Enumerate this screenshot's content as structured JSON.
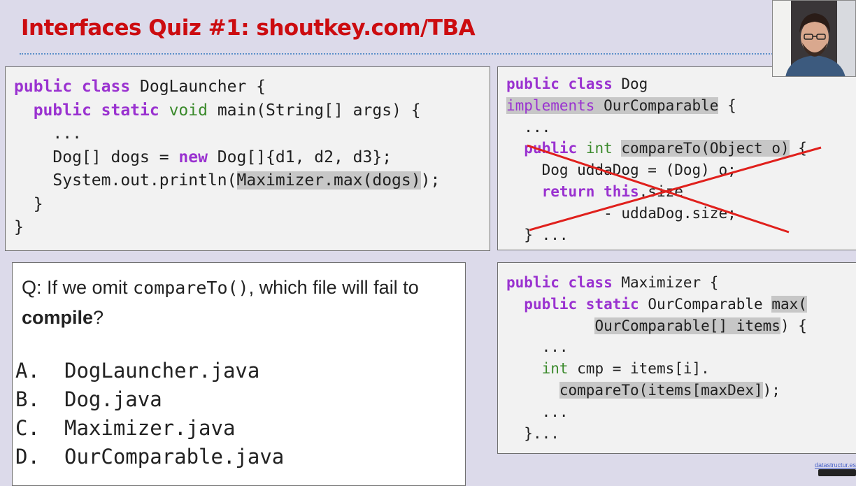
{
  "slide": {
    "title": "Interfaces Quiz #1: shoutkey.com/TBA",
    "footer_link": "datastructur.es"
  },
  "code_launcher": {
    "line1_kw": "public class",
    "line1_rest": " DogLauncher {",
    "line2_kw": "public static",
    "line2_type": "void",
    "line2_rest": " main(String[] args) {",
    "line3": "...",
    "line4_a": "Dog[] dogs = ",
    "line4_kw": "new",
    "line4_b": " Dog[]{d1, d2, d3};",
    "line5_a": "System.out.println(",
    "line5_hl": "Maximizer.max(dogs)",
    "line5_b": ");",
    "line6": "}",
    "line7": "}"
  },
  "code_dog": {
    "line1_kw": "public class",
    "line1_rest": " Dog",
    "line2_kw": "implements",
    "line2_hl": " OurComparable",
    "line2_rest": " {",
    "line3": "...",
    "line4_kw": "public",
    "line4_type": "int",
    "line4_hl": "compareTo(Object o)",
    "line4_rest": " {",
    "line5": "Dog uddaDog = (Dog) o;",
    "line6_kw": "return this",
    "line6_rest": ".size",
    "line7": "- uddaDog.size;",
    "line8": "} ..."
  },
  "question": {
    "prefix": "Q: If we omit ",
    "code": "compareTo()",
    "middle": ", which file will fail to ",
    "bold": "compile",
    "suffix": "?",
    "choices": [
      {
        "letter": "A.",
        "text": "DogLauncher.java"
      },
      {
        "letter": "B.",
        "text": "Dog.java"
      },
      {
        "letter": "C.",
        "text": "Maximizer.java"
      },
      {
        "letter": "D.",
        "text": "OurComparable.java"
      }
    ]
  },
  "code_maximizer": {
    "line1_kw": "public class",
    "line1_rest": " Maximizer {",
    "line2_kw": "public static",
    "line2_mid": " OurComparable ",
    "line2_hl": "max(",
    "line3_hl": "OurComparable[] items",
    "line3_rest": ") {",
    "line4": "...",
    "line5_type": "int",
    "line5_rest": " cmp = items[i].",
    "line6_hl": "compareTo(items[maxDex]",
    "line6_rest": ");",
    "line7": "...",
    "line8": "}..."
  },
  "colors": {
    "title_red": "#cc0c10",
    "keyword_purple": "#9a32d0",
    "type_green": "#3b8a2c",
    "strike_red": "#e0201c",
    "highlight_gray": "#c7c7c7"
  }
}
